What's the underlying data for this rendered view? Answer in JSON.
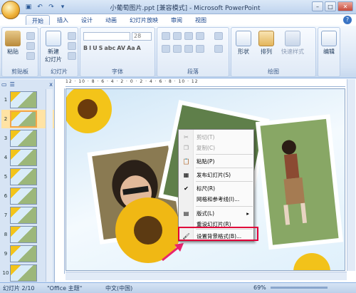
{
  "window": {
    "title": "小葡萄图片.ppt [兼容模式] - Microsoft PowerPoint",
    "controls": [
      "–",
      "□",
      "✕"
    ]
  },
  "quick_access": [
    "save-icon",
    "undo-icon",
    "redo-icon",
    "customize-icon"
  ],
  "ribbon": {
    "tabs": [
      "开始",
      "插入",
      "设计",
      "动画",
      "幻灯片放映",
      "审阅",
      "视图"
    ],
    "active_tab": "开始",
    "help": "?",
    "groups": {
      "clipboard": {
        "label": "剪贴板",
        "paste": "粘贴"
      },
      "slides": {
        "label": "幻灯片",
        "new_slide": "新建",
        "new_slide2": "幻灯片"
      },
      "font": {
        "label": "字体",
        "size": "28"
      },
      "paragraph": {
        "label": "段落"
      },
      "drawing": {
        "label": "绘图",
        "shape": "形状",
        "arrange": "排列",
        "quick_style": "快速样式"
      },
      "editing": {
        "label": "编辑"
      }
    },
    "format_buttons": [
      "B",
      "I",
      "U",
      "S",
      "abc",
      "AV",
      "Aa",
      "A"
    ]
  },
  "slides_pane": {
    "tab_icons": [
      "slides-tab-icon",
      "outline-tab-icon"
    ],
    "close": "x",
    "thumbnails": [
      1,
      2,
      3,
      4,
      5,
      6,
      7,
      8,
      9,
      10
    ],
    "selected": 2
  },
  "ruler": "12 · 10 · 8 · 6 · 4 · 2 · 0 · 2 · 4 · 6 · 8 · 10 · 12",
  "context_menu": {
    "items": [
      {
        "label": "剪切(T)",
        "icon": "scissors-icon",
        "glyph": "✂",
        "disabled": true
      },
      {
        "label": "复制(C)",
        "icon": "copy-icon",
        "glyph": "❐",
        "disabled": true
      },
      {
        "label": "粘贴(P)",
        "icon": "paste-icon",
        "glyph": "📋",
        "disabled": false
      },
      {
        "label": "发布幻灯片(S)",
        "icon": "publish-icon",
        "glyph": "▦",
        "disabled": false
      },
      {
        "label": "标尺(R)",
        "icon": "check-icon",
        "glyph": "✔",
        "disabled": false
      },
      {
        "label": "网格和参考线(I)...",
        "icon": "grid-icon",
        "glyph": "",
        "disabled": false
      },
      {
        "label": "版式(L)",
        "icon": "layout-icon",
        "glyph": "▤",
        "disabled": false,
        "submenu": "▸"
      },
      {
        "label": "重设幻灯片(R)",
        "icon": "reset-icon",
        "glyph": "",
        "disabled": false
      },
      {
        "label": "设置背景格式(B)...",
        "icon": "background-icon",
        "glyph": "🖌",
        "disabled": false
      }
    ]
  },
  "statusbar": {
    "slide": "幻灯片 2/10",
    "theme": "\"Office 主题\"",
    "language": "中文(中国)",
    "zoom": "69%"
  },
  "colors": {
    "highlight": "#e0003a",
    "arrow": "#e8246e"
  }
}
